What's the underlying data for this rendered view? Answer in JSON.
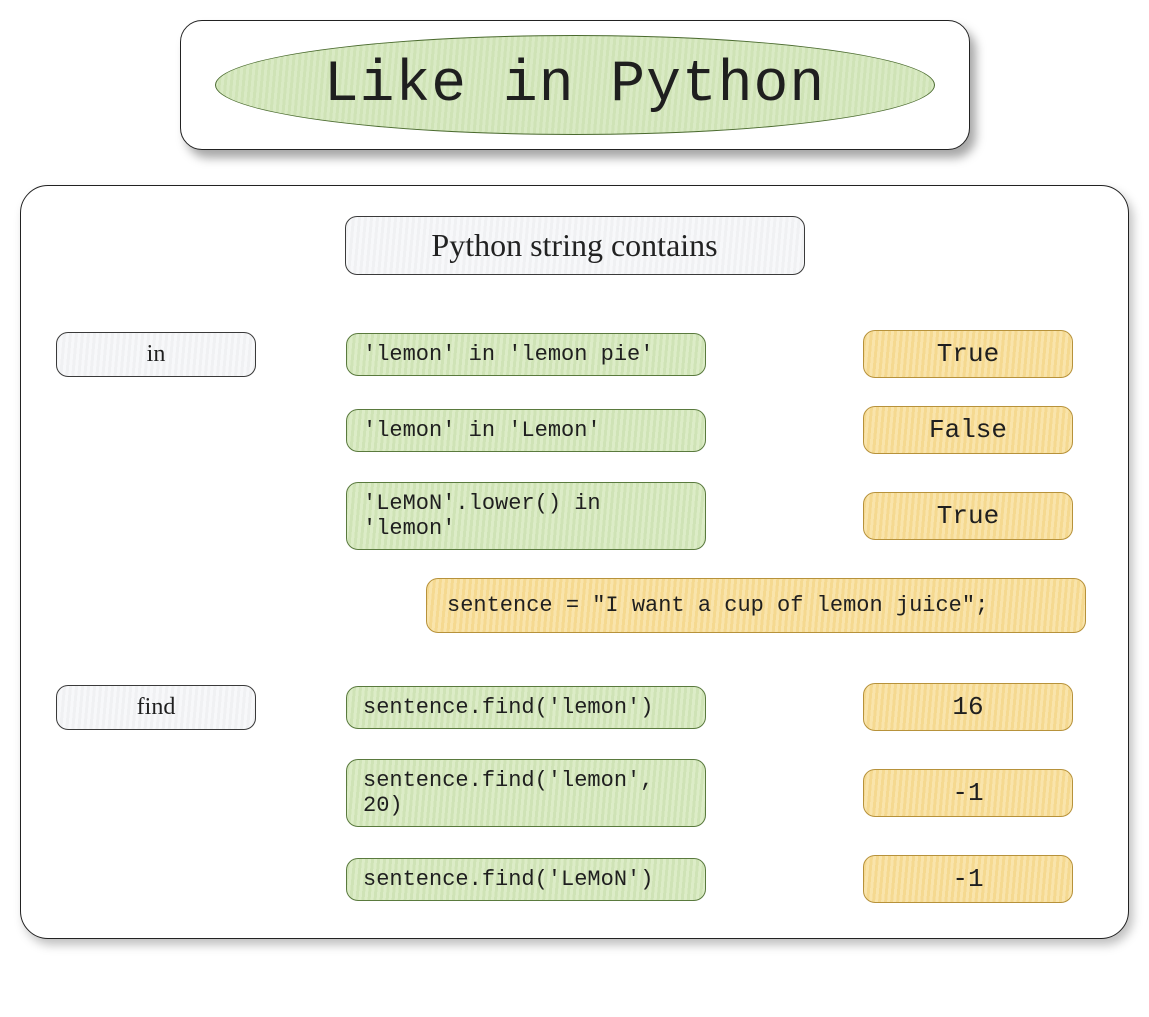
{
  "header": {
    "title": "Like in Python"
  },
  "main": {
    "subtitle": "Python string contains",
    "sections": {
      "in": {
        "label": "in",
        "rows": [
          {
            "code": "'lemon' in 'lemon pie'",
            "result": "True"
          },
          {
            "code": "'lemon' in 'Lemon'",
            "result": "False"
          },
          {
            "code": "'LeMoN'.lower() in 'lemon'",
            "result": "True"
          }
        ]
      },
      "sentence": {
        "code": "sentence = \"I want a cup of lemon juice\";"
      },
      "find": {
        "label": "find",
        "rows": [
          {
            "code": "sentence.find('lemon')",
            "result": "16"
          },
          {
            "code": "sentence.find('lemon', 20)",
            "result": "-1"
          },
          {
            "code": "sentence.find('LeMoN')",
            "result": "-1"
          }
        ]
      }
    }
  }
}
